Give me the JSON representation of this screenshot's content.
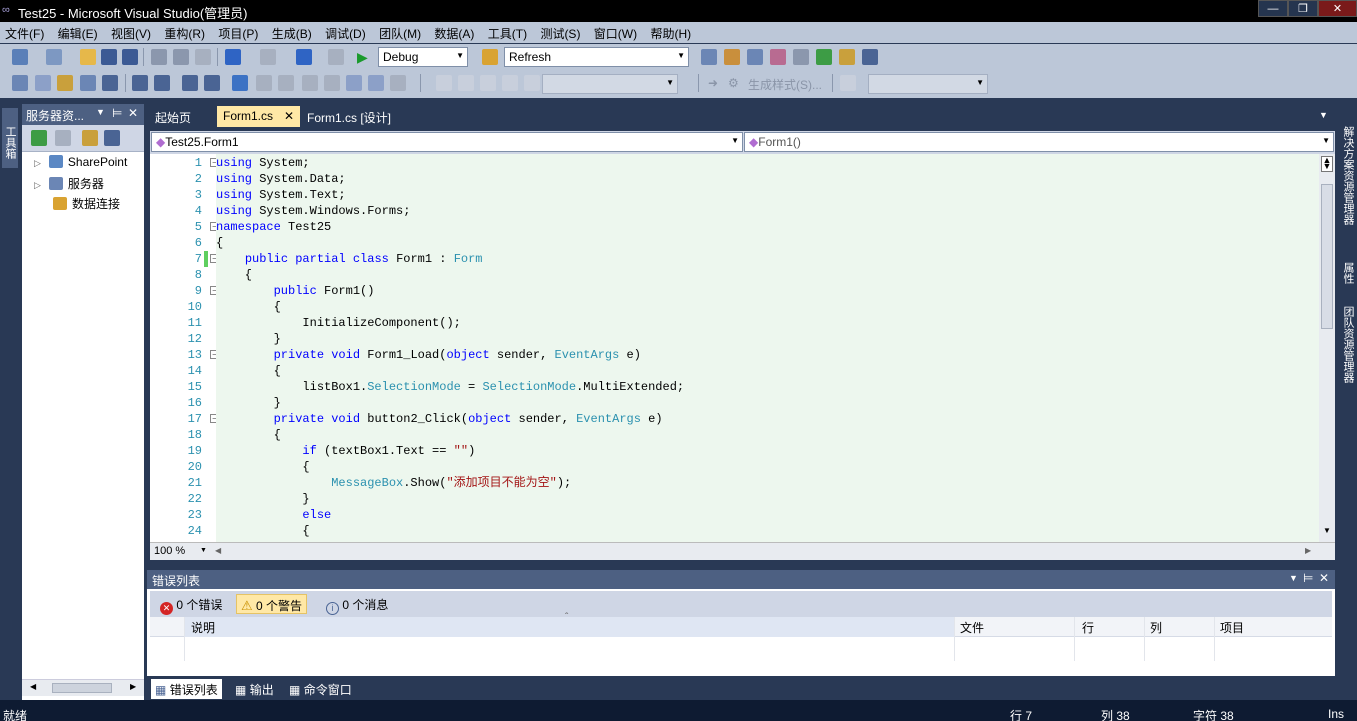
{
  "window": {
    "title": "Test25 - Microsoft Visual Studio(管理员)"
  },
  "menu": [
    "文件(F)",
    "编辑(E)",
    "视图(V)",
    "重构(R)",
    "项目(P)",
    "生成(B)",
    "调试(D)",
    "团队(M)",
    "数据(A)",
    "工具(T)",
    "测试(S)",
    "窗口(W)",
    "帮助(H)"
  ],
  "toolbar": {
    "config": "Debug",
    "find": "Refresh",
    "build_style_label": "生成样式(S)..."
  },
  "toolbox_tab": "工具箱",
  "server_explorer": {
    "title": "服务器资...",
    "items": [
      "SharePoint",
      "服务器",
      "数据连接"
    ]
  },
  "doc_tabs": [
    {
      "label": "起始页"
    },
    {
      "label": "Form1.cs",
      "active": true
    },
    {
      "label": "Form1.cs [设计]"
    }
  ],
  "nav": {
    "class": "Test25.Form1",
    "member": "Form1()"
  },
  "code_lines": [
    "using System;",
    "using System.Data;",
    "using System.Text;",
    "using System.Windows.Forms;",
    "namespace Test25",
    "{",
    "    public partial class Form1 : Form",
    "    {",
    "        public Form1()",
    "        {",
    "            InitializeComponent();",
    "        }",
    "        private void Form1_Load(object sender, EventArgs e)",
    "        {",
    "            listBox1.SelectionMode = SelectionMode.MultiExtended;",
    "        }",
    "        private void button2_Click(object sender, EventArgs e)",
    "        {",
    "            if (textBox1.Text == \"\")",
    "            {",
    "                MessageBox.Show(\"添加项目不能为空\");",
    "            }",
    "            else",
    "            {"
  ],
  "zoom": "100 %",
  "error_list": {
    "title": "错误列表",
    "errors": "0 个错误",
    "warnings": "0 个警告",
    "messages": "0 个消息",
    "columns": [
      "说明",
      "文件",
      "行",
      "列",
      "项目"
    ]
  },
  "bottom_tabs": [
    "错误列表",
    "输出",
    "命令窗口"
  ],
  "status": {
    "ready": "就绪",
    "line": "行 7",
    "col": "列 38",
    "char": "字符 38",
    "mode": "Ins"
  },
  "right_tabs": [
    "解决方案资源管理器",
    "属性",
    "团队资源管理器"
  ],
  "colors": {
    "accent": "#ffe8a6",
    "chrome": "#293955",
    "keyword": "#0000ff",
    "type": "#2b91af",
    "string": "#a31515"
  }
}
